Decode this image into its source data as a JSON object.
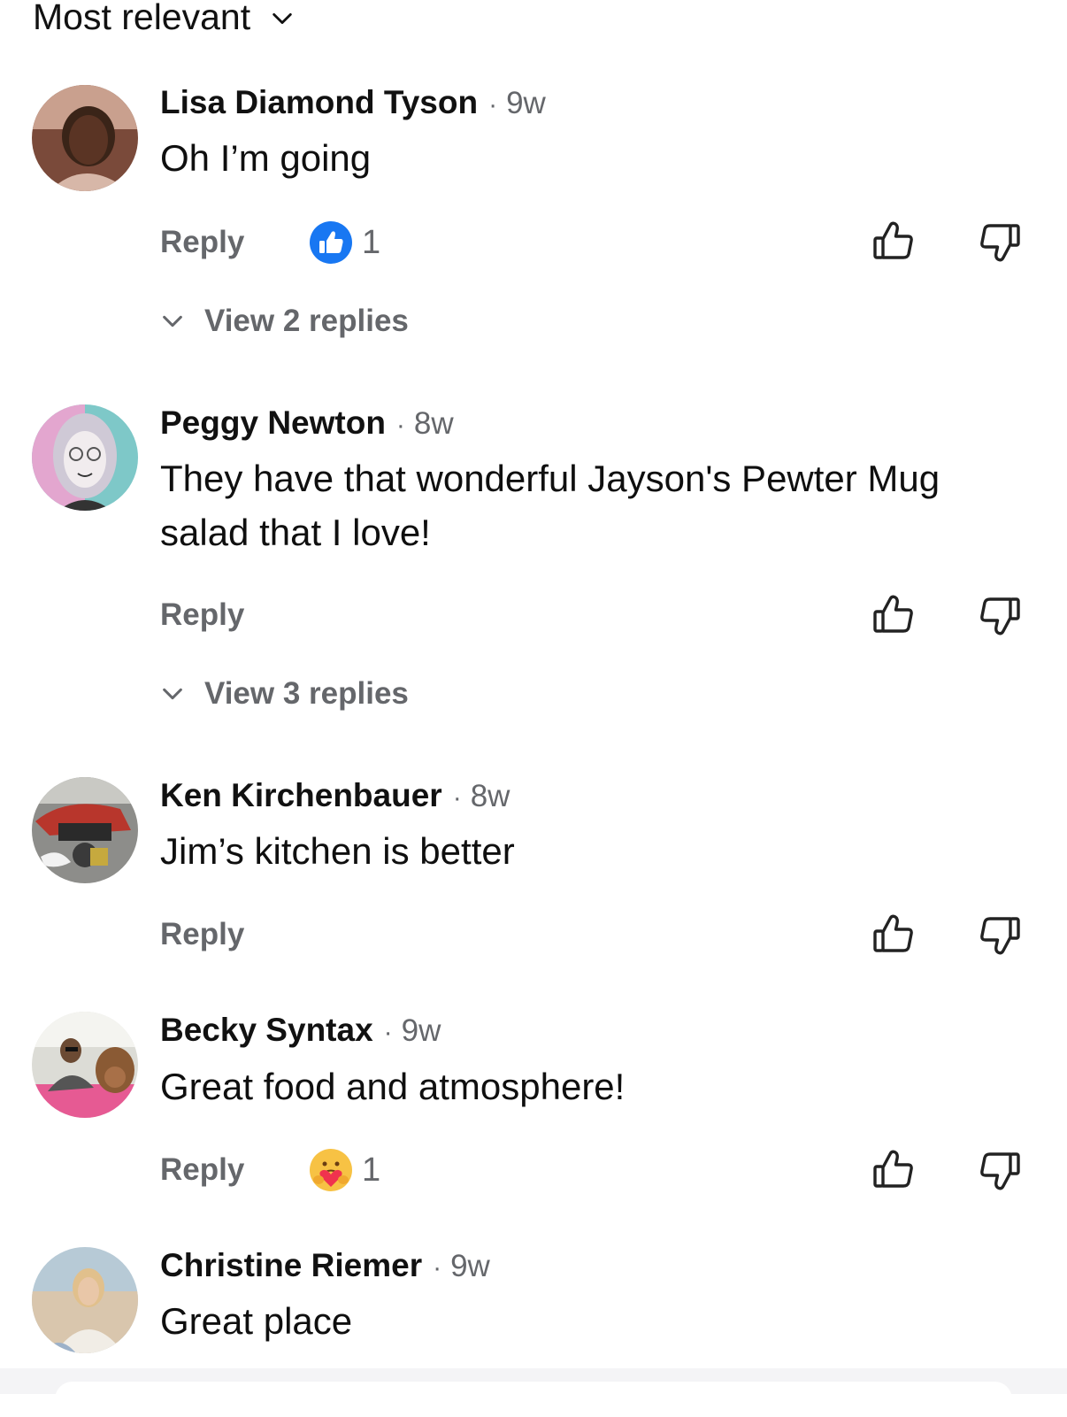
{
  "sort": {
    "label": "Most relevant"
  },
  "comments": [
    {
      "name": "Lisa Diamond Tyson",
      "time": "9w",
      "text": "Oh I’m going",
      "reply_label": "Reply",
      "reaction": {
        "icon": "like-reaction-icon",
        "count": "1"
      },
      "view_replies": "View 2 replies"
    },
    {
      "name": "Peggy Newton",
      "time": "8w",
      "text_lines": [
        "They have that wonderful Jayson's Pewter Mug",
        "salad that I love!"
      ],
      "reply_label": "Reply",
      "view_replies": "View 3 replies"
    },
    {
      "name": "Ken Kirchenbauer",
      "time": "8w",
      "text": "Jim’s kitchen is better",
      "reply_label": "Reply"
    },
    {
      "name": "Becky Syntax",
      "time": "9w",
      "text": "Great food and atmosphere!",
      "reply_label": "Reply",
      "reaction": {
        "icon": "care-reaction-icon",
        "count": "1"
      }
    },
    {
      "name": "Christine Riemer",
      "time": "9w",
      "text": "Great place"
    }
  ],
  "separator": "·",
  "colors": {
    "like_blue": "#1877f2",
    "muted": "#65676b",
    "text": "#0f0f0f"
  }
}
